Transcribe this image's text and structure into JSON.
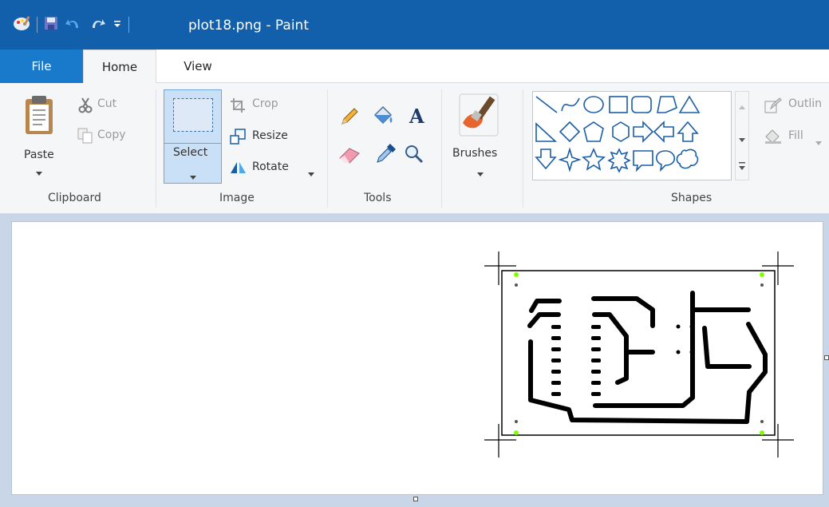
{
  "window": {
    "title": "plot18.png - Paint"
  },
  "tabs": {
    "file": "File",
    "home": "Home",
    "view": "View"
  },
  "clipboard": {
    "paste": "Paste",
    "cut": "Cut",
    "copy": "Copy",
    "group": "Clipboard"
  },
  "image": {
    "select": "Select",
    "crop": "Crop",
    "resize": "Resize",
    "rotate": "Rotate",
    "group": "Image"
  },
  "tools": {
    "group": "Tools"
  },
  "brushes": {
    "label": "Brushes"
  },
  "shapes": {
    "group": "Shapes",
    "outline": "Outlin",
    "fill": "Fill"
  },
  "colors": {
    "title_bar": "#1260ab",
    "file_tab": "#1979ca",
    "select_bg": "#c9e0f7",
    "shape_blue": "#1a5ea8",
    "pcb_trace": "#000000",
    "pad_green": "#7fff00"
  }
}
